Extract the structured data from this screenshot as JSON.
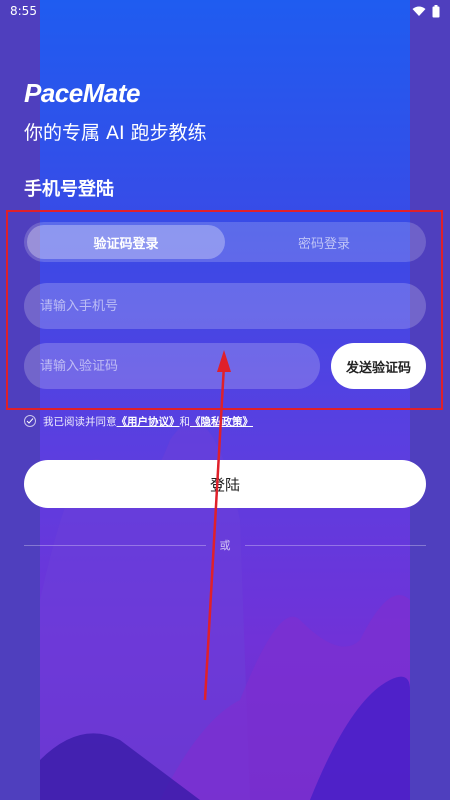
{
  "status_bar": {
    "time": "8:55"
  },
  "app": {
    "brand": "PaceMate",
    "tagline": "你的专属 AI 跑步教练"
  },
  "login": {
    "title": "手机号登陆",
    "tabs": [
      {
        "label": "验证码登录",
        "active": true
      },
      {
        "label": "密码登录",
        "active": false
      }
    ],
    "phone_placeholder": "请输入手机号",
    "code_placeholder": "请输入验证码",
    "send_code_label": "发送验证码",
    "agreement": {
      "prefix": "我已阅读并同意",
      "user_agreement": "《用户协议》",
      "and": "和",
      "privacy_policy": "《隐私政策》"
    },
    "submit_label": "登陆",
    "or_label": "或"
  },
  "colors": {
    "highlight": "#e0202a",
    "bg_top": "#1f5cf0",
    "bg_bottom": "#6a2ec8"
  }
}
